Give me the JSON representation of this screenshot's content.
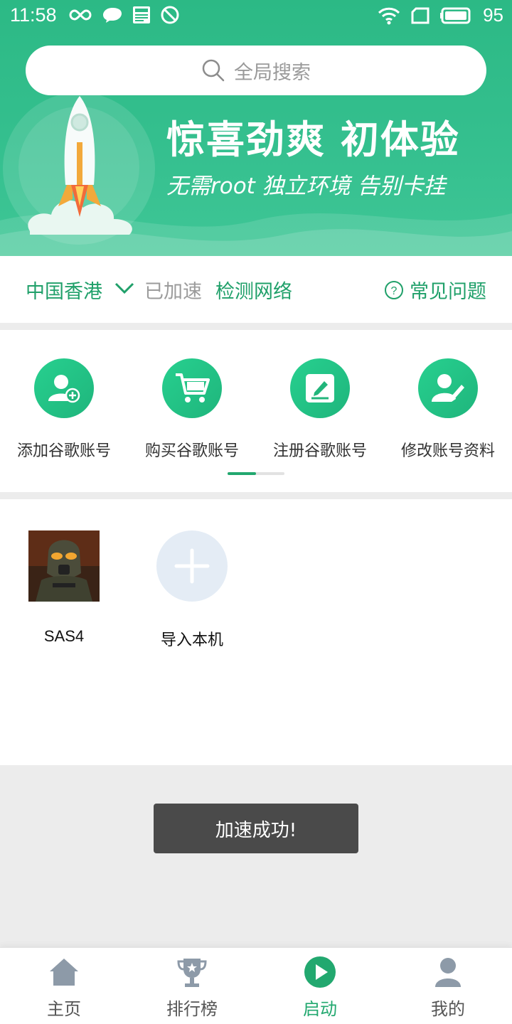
{
  "status_bar": {
    "time": "11:58",
    "battery": "95"
  },
  "search": {
    "placeholder": "全局搜索"
  },
  "banner": {
    "title": "惊喜劲爽  初体验",
    "subtitle": "无需root  独立环境  告别卡挂"
  },
  "region": {
    "location": "中国香港",
    "status": "已加速",
    "check_network": "检测网络",
    "faq": "常见问题"
  },
  "actions": [
    {
      "label": "添加谷歌账号",
      "icon": "add-user-icon"
    },
    {
      "label": "购买谷歌账号",
      "icon": "shopping-cart-icon"
    },
    {
      "label": "注册谷歌账号",
      "icon": "edit-note-icon"
    },
    {
      "label": "修改账号资料",
      "icon": "edit-profile-icon"
    }
  ],
  "apps": [
    {
      "name": "SAS4"
    },
    {
      "name": "导入本机"
    }
  ],
  "toast": "加速成功!",
  "tabs": [
    {
      "label": "主页",
      "icon": "home-icon"
    },
    {
      "label": "排行榜",
      "icon": "trophy-icon"
    },
    {
      "label": "启动",
      "icon": "play-icon"
    },
    {
      "label": "我的",
      "icon": "user-icon"
    }
  ],
  "colors": {
    "brand_green": "#22a86f",
    "banner_green": "#2cb985",
    "toast_bg": "#4a4a4a"
  }
}
